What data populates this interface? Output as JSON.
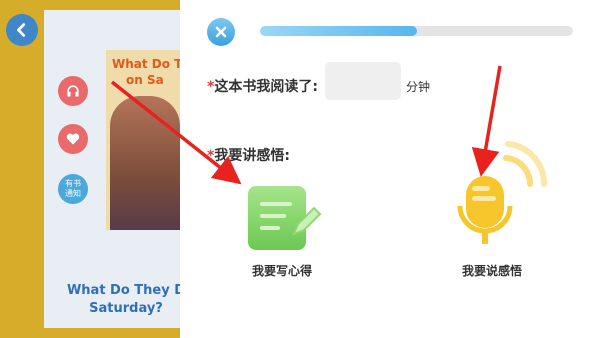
{
  "background": {
    "book_title": "What Do They D… Saturday?",
    "book_title_line1": "What Do They D",
    "book_title_line2": "Saturday?",
    "cover_title": "What Do T… on Sa…",
    "cover_title_line1": "What Do T",
    "cover_title_line2": "on Sa",
    "side_badge_label": "有书通知",
    "side_badge_line1": "有书",
    "side_badge_line2": "通知"
  },
  "panel": {
    "progress_percent": 50,
    "reading_time": {
      "required_mark": "*",
      "label": "这本书我阅读了:",
      "value": "",
      "placeholder": "",
      "unit": "分钟"
    },
    "share": {
      "required_mark": "*",
      "label": "我要讲感悟:",
      "options": [
        {
          "label": "我要写心得",
          "icon": "write-notes-icon"
        },
        {
          "label": "我要说感悟",
          "icon": "microphone-icon"
        }
      ]
    }
  },
  "colors": {
    "accent_blue": "#56b6ee",
    "write_green": "#6cc853",
    "mic_yellow": "#f6c62c",
    "required_red": "#e23b3b",
    "arrow_red": "#e8231f"
  }
}
